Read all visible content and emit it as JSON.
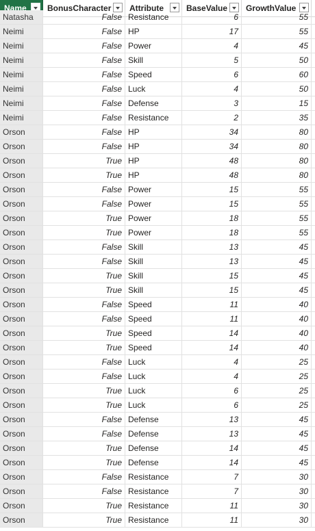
{
  "columns": [
    "Name",
    "BonusCharacter",
    "Attribute",
    "BaseValue",
    "GrowthValue"
  ],
  "rows": [
    [
      "Natasha",
      "False",
      "Resistance",
      "6",
      "55"
    ],
    [
      "Neimi",
      "False",
      "HP",
      "17",
      "55"
    ],
    [
      "Neimi",
      "False",
      "Power",
      "4",
      "45"
    ],
    [
      "Neimi",
      "False",
      "Skill",
      "5",
      "50"
    ],
    [
      "Neimi",
      "False",
      "Speed",
      "6",
      "60"
    ],
    [
      "Neimi",
      "False",
      "Luck",
      "4",
      "50"
    ],
    [
      "Neimi",
      "False",
      "Defense",
      "3",
      "15"
    ],
    [
      "Neimi",
      "False",
      "Resistance",
      "2",
      "35"
    ],
    [
      "Orson",
      "False",
      "HP",
      "34",
      "80"
    ],
    [
      "Orson",
      "False",
      "HP",
      "34",
      "80"
    ],
    [
      "Orson",
      "True",
      "HP",
      "48",
      "80"
    ],
    [
      "Orson",
      "True",
      "HP",
      "48",
      "80"
    ],
    [
      "Orson",
      "False",
      "Power",
      "15",
      "55"
    ],
    [
      "Orson",
      "False",
      "Power",
      "15",
      "55"
    ],
    [
      "Orson",
      "True",
      "Power",
      "18",
      "55"
    ],
    [
      "Orson",
      "True",
      "Power",
      "18",
      "55"
    ],
    [
      "Orson",
      "False",
      "Skill",
      "13",
      "45"
    ],
    [
      "Orson",
      "False",
      "Skill",
      "13",
      "45"
    ],
    [
      "Orson",
      "True",
      "Skill",
      "15",
      "45"
    ],
    [
      "Orson",
      "True",
      "Skill",
      "15",
      "45"
    ],
    [
      "Orson",
      "False",
      "Speed",
      "11",
      "40"
    ],
    [
      "Orson",
      "False",
      "Speed",
      "11",
      "40"
    ],
    [
      "Orson",
      "True",
      "Speed",
      "14",
      "40"
    ],
    [
      "Orson",
      "True",
      "Speed",
      "14",
      "40"
    ],
    [
      "Orson",
      "False",
      "Luck",
      "4",
      "25"
    ],
    [
      "Orson",
      "False",
      "Luck",
      "4",
      "25"
    ],
    [
      "Orson",
      "True",
      "Luck",
      "6",
      "25"
    ],
    [
      "Orson",
      "True",
      "Luck",
      "6",
      "25"
    ],
    [
      "Orson",
      "False",
      "Defense",
      "13",
      "45"
    ],
    [
      "Orson",
      "False",
      "Defense",
      "13",
      "45"
    ],
    [
      "Orson",
      "True",
      "Defense",
      "14",
      "45"
    ],
    [
      "Orson",
      "True",
      "Defense",
      "14",
      "45"
    ],
    [
      "Orson",
      "False",
      "Resistance",
      "7",
      "30"
    ],
    [
      "Orson",
      "False",
      "Resistance",
      "7",
      "30"
    ],
    [
      "Orson",
      "True",
      "Resistance",
      "11",
      "30"
    ],
    [
      "Orson",
      "True",
      "Resistance",
      "11",
      "30"
    ]
  ],
  "colors": {
    "selected_header_bg": "#217346",
    "key_column_bg": "#e9e9e9",
    "gridline": "#e1e1e1"
  },
  "icons": {
    "filter": "chevron-down-icon"
  }
}
